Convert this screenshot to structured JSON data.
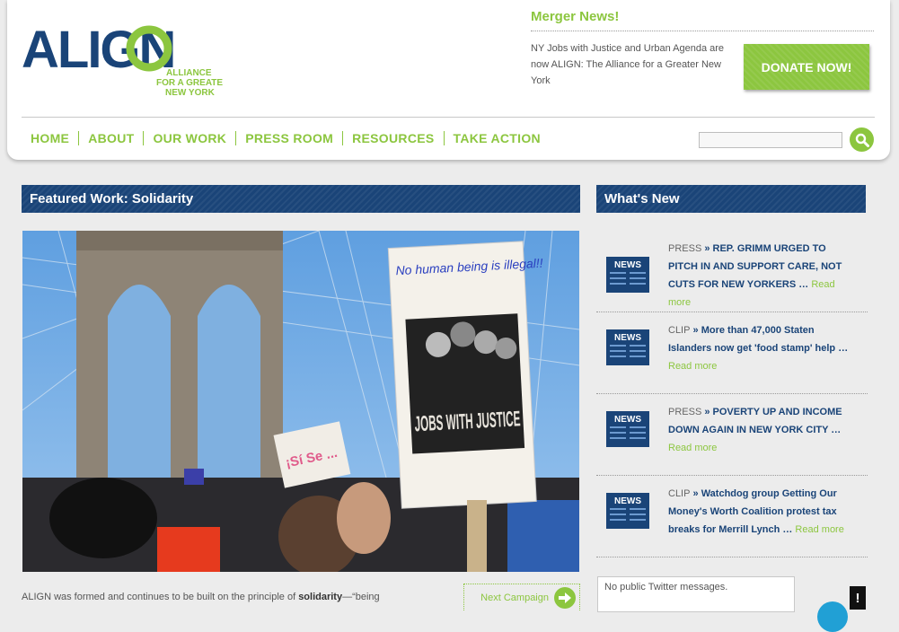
{
  "brand": {
    "logo_word": "ALIGN",
    "logo_sub": [
      "ALLIANCE",
      "FOR A GREATER",
      "NEW YORK"
    ]
  },
  "merger": {
    "title": "Merger News!",
    "text": "NY Jobs with Justice and Urban Agenda are now ALIGN: The Alliance for a Greater New York"
  },
  "donate_label": "DONATE NOW!",
  "nav": [
    "HOME",
    "ABOUT",
    "OUR WORK",
    "PRESS ROOM",
    "RESOURCES",
    "TAKE ACTION"
  ],
  "search": {
    "value": "",
    "icon": "search-icon"
  },
  "featured": {
    "title": "Featured Work: Solidarity",
    "sign_top": "No human being is illegal!!",
    "sign_main": "JOBS WITH JUSTICE",
    "sign_small": "¡Sí Se ..."
  },
  "intro": {
    "before": "ALIGN was formed and continues to be built on the principle of ",
    "bold": "solidarity",
    "after": "—“being"
  },
  "next_campaign": "Next Campaign",
  "whats_new": {
    "title": "What's New",
    "icon_label": "NEWS",
    "items": [
      {
        "kind": "PRESS",
        "headline": "REP. GRIMM URGED TO PITCH IN AND SUPPORT CARE, NOT CUTS FOR NEW YORKERS …",
        "more": "Read more"
      },
      {
        "kind": "CLIP",
        "headline": "More than 47,000 Staten Islanders now get 'food stamp' help …",
        "more": "Read more"
      },
      {
        "kind": "PRESS",
        "headline": "POVERTY UP AND INCOME DOWN AGAIN IN NEW YORK CITY …",
        "more": "Read more"
      },
      {
        "kind": "CLIP",
        "headline": "Watchdog group Getting Our Money's Worth Coalition protest tax breaks for Merrill Lynch …",
        "more": "Read more"
      }
    ]
  },
  "twitter": "No public Twitter messages.",
  "feedback_label": "!",
  "colors": {
    "green": "#8cc63f",
    "navy": "#1a4478",
    "blue_dot": "#21a0d5"
  }
}
